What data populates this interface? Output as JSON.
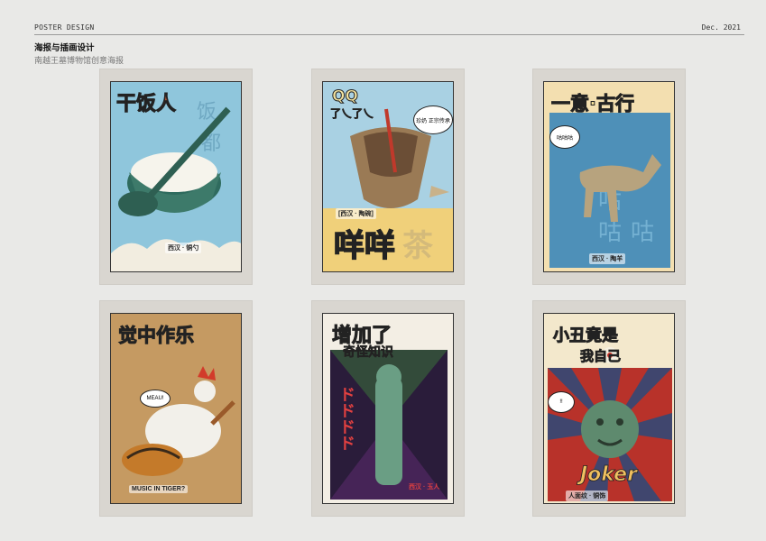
{
  "header": {
    "left_label": "POSTER DESIGN",
    "right_label": "Dec.   2021",
    "title": "海报与插画设计",
    "subtitle": "南越王墓博物馆创意海报"
  },
  "posters": [
    {
      "headline": "干饭人",
      "caption": "西汉 · 铜勺",
      "bg": "#8fc6dc"
    },
    {
      "headline_top": "QQ",
      "headline_mid": "了乀了乀",
      "bubble": "珍奶 正宗传承",
      "caption": "[西汉 · 陶碗]",
      "big": "咩咩",
      "big_faint": "茶",
      "bg": "#f0d07a"
    },
    {
      "headline": "一意·古行",
      "bubble": "咕咕咕",
      "caption": "西汉 · 陶羊",
      "bg": "#4e90b8"
    },
    {
      "headline": "觉中作乐",
      "bubble": "MEAU!",
      "caption": "MUSIC IN TIGER?",
      "bg": "#c59a62"
    },
    {
      "headline": "增加了",
      "sub": "奇怪知识",
      "mark": "ドドドド",
      "caption": "西汉 · 玉人",
      "bg": "#2a1c3a"
    },
    {
      "headline": "小丑竟是",
      "headline2": "我自己",
      "bubble": "!!",
      "caption": "人面纹 · 铜饰",
      "script": "Joker",
      "bg": "#b8322a"
    }
  ]
}
